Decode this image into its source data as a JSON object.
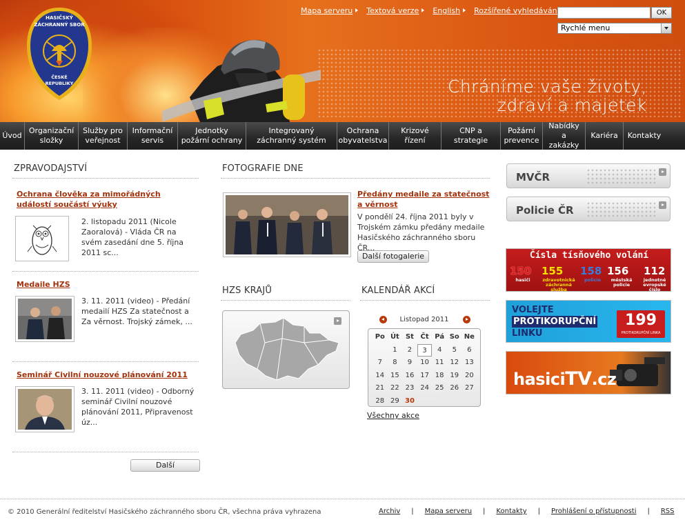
{
  "header": {
    "logo_text": "HASIČSKÝ ZÁCHRANNÝ SBOR ČESKÉ REPUBLIKY",
    "slogan_line1": "Chráníme vaše životy,",
    "slogan_line2": "zdraví a majetek",
    "top_links": [
      "Mapa serveru",
      "Textová verze",
      "English",
      "Rozšířené vyhledávání"
    ],
    "search": {
      "value": "",
      "button": "OK"
    },
    "quick_menu": "Rychlé menu"
  },
  "nav": [
    "Úvod",
    "Organizační složky",
    "Služby pro veřejnost",
    "Informační servis",
    "Jednotky požární ochrany",
    "Integrovaný záchranný systém",
    "Ochrana obyvatelstva",
    "Krizové řízení",
    "CNP a strategie",
    "Požární prevence",
    "Nabídky a zakázky",
    "Kariéra",
    "Kontakty"
  ],
  "news": {
    "heading": "ZPRAVODAJSTVÍ",
    "items": [
      {
        "title": "Ochrana člověka za mimořádných událostí součástí výuky",
        "text": "2. listopadu 2011 (Nicole Zaoralová) - Vláda ČR na svém zasedání dne 5. října 2011 sc..."
      },
      {
        "title": "Medaile HZS",
        "text": "3. 11. 2011 (video) - Předání medailí HZS Za statečnost a Za věrnost. Trojský zámek, ..."
      },
      {
        "title": "Seminář Civilní nouzové plánování 2011",
        "text": "3. 11. 2011 (video) - Odborný seminář Civilní nouzové plánování 2011, Připravenost úz..."
      }
    ],
    "more_button": "Další"
  },
  "photo": {
    "heading": "FOTOGRAFIE DNE",
    "title": "Předány medaile za statečnost a věrnost",
    "text": "V pondělí 24. října 2011 byly v Trojském zámku předány medaile Hasičského záchranného sboru ČR...",
    "button": "Další fotogalerie"
  },
  "regions": {
    "heading": "HZS KRAJŮ"
  },
  "calendar": {
    "heading": "KALENDÁŘ AKCÍ",
    "month": "Listopad 2011",
    "days": [
      "Po",
      "Út",
      "St",
      "Čt",
      "Pá",
      "So",
      "Ne"
    ],
    "cells": [
      "",
      "1",
      "2",
      "3",
      "4",
      "5",
      "6",
      "7",
      "8",
      "9",
      "10",
      "11",
      "12",
      "13",
      "14",
      "15",
      "16",
      "17",
      "18",
      "19",
      "20",
      "21",
      "22",
      "23",
      "24",
      "25",
      "26",
      "27",
      "28",
      "29",
      "30",
      "",
      "",
      "",
      ""
    ],
    "today": "3",
    "event_day": "30",
    "all_link": "Všechny akce"
  },
  "side": {
    "buttons": [
      "MVČR",
      "Policie ČR"
    ],
    "emergency": {
      "title": "Čísla tísňového volání",
      "numbers": [
        "150",
        "155",
        "158",
        "156",
        "112"
      ],
      "labels": [
        "hasiči",
        "zdravotnická záchranná služba",
        "policie",
        "městská policie",
        "jednotné evropské číslo"
      ]
    },
    "anticorruption": {
      "line1": "VOLEJTE",
      "line2": "PROTIKORUPČNÍ",
      "line3": "LINKU",
      "number": "199",
      "sub": "PROTIKORUPČNÍ LINKA"
    },
    "tv": {
      "text1": "hasici",
      "text2": "TV",
      "text3": ".cz"
    }
  },
  "footer": {
    "copyright": "© 2010 Generální ředitelství Hasičského záchranného sboru ČR, všechna práva vyhrazena",
    "links": [
      "Archiv",
      "Mapa serveru",
      "Kontakty",
      "Prohlášení o přístupnosti",
      "RSS"
    ]
  },
  "colors": {
    "accent": "#a3320c",
    "header_orange": "#e06218",
    "nav_dark": "#262626"
  }
}
